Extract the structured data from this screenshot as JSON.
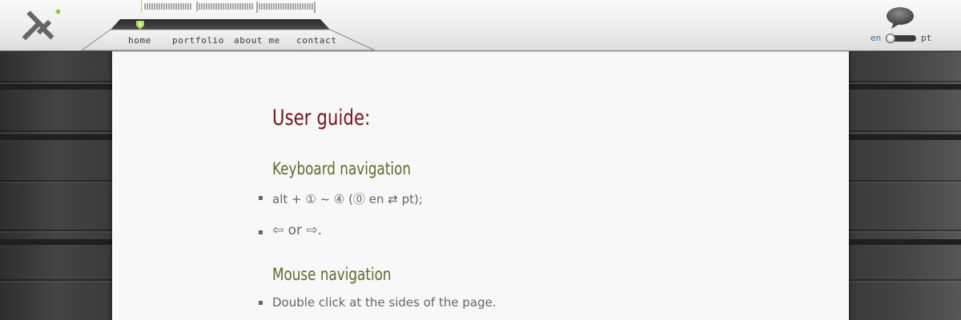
{
  "nav": {
    "items": [
      {
        "label": "home"
      },
      {
        "label": "portfolio"
      },
      {
        "label": "about me"
      },
      {
        "label": "contact"
      }
    ]
  },
  "language": {
    "options": [
      "en",
      "pt"
    ],
    "selected": "en"
  },
  "guide": {
    "title": "User guide:",
    "keyboard": {
      "title": "Keyboard navigation",
      "items": [
        "alt + ① ~ ④ (⓪ en ⇄ pt);",
        "⇦ or ⇨."
      ]
    },
    "mouse": {
      "title": "Mouse navigation",
      "items": [
        "Double click at the sides of the page."
      ]
    }
  },
  "colors": {
    "title": "#7a1212",
    "section": "#5c6b2a",
    "accent": "#8dc63f",
    "lang_active": "#2a6fb0"
  },
  "icons": [
    "logo-icon",
    "speech-bubble-icon",
    "nav-indicator-icon"
  ]
}
